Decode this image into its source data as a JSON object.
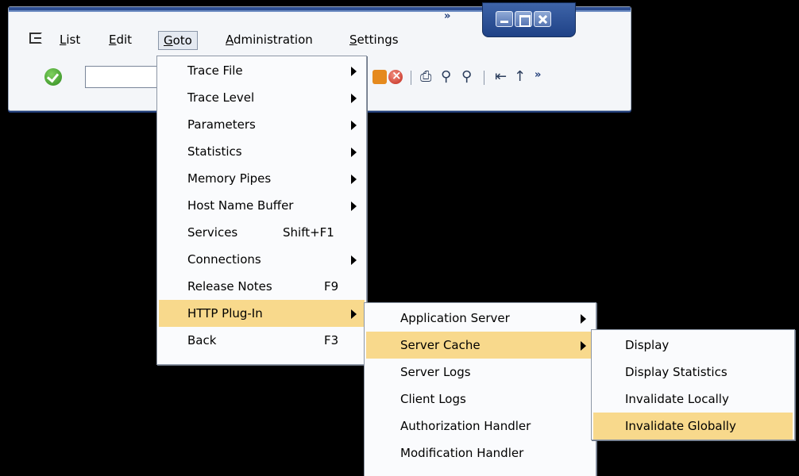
{
  "window": {
    "controls": {
      "more": "»",
      "minimize_icon": "minimize-icon",
      "maximize_icon": "maximize-icon",
      "close_icon": "close-icon"
    }
  },
  "menubar": {
    "items": [
      "List",
      "Edit",
      "Goto",
      "Administration",
      "Settings"
    ],
    "mnemonics": [
      "L",
      "E",
      "G",
      "A",
      "S"
    ]
  },
  "toolbar": {
    "command_field_value": "",
    "more": "»",
    "icons": [
      "enter-icon",
      "exit-icon",
      "cancel-icon",
      "print-icon",
      "find-icon",
      "find-next-icon",
      "first-page-icon",
      "previous-page-icon"
    ]
  },
  "goto_menu": {
    "items": [
      {
        "label": "Trace File",
        "submenu": true
      },
      {
        "label": "Trace Level",
        "submenu": true
      },
      {
        "label": "Parameters",
        "submenu": true
      },
      {
        "label": "Statistics",
        "submenu": true
      },
      {
        "label": "Memory Pipes",
        "submenu": true
      },
      {
        "label": "Host Name Buffer",
        "submenu": true
      },
      {
        "label": "Services",
        "shortcut": "Shift+F1"
      },
      {
        "label": "Connections",
        "submenu": true
      },
      {
        "label": "Release Notes",
        "shortcut": "F9"
      },
      {
        "label": "HTTP Plug-In",
        "submenu": true,
        "highlighted": true
      },
      {
        "label": "Back",
        "shortcut": "F3"
      }
    ]
  },
  "http_plugin_submenu": {
    "items": [
      {
        "label": "Application Server",
        "submenu": true
      },
      {
        "label": "Server Cache",
        "submenu": true,
        "highlighted": true
      },
      {
        "label": "Server Logs"
      },
      {
        "label": "Client Logs"
      },
      {
        "label": "Authorization Handler"
      },
      {
        "label": "Modification Handler"
      }
    ]
  },
  "server_cache_submenu": {
    "items": [
      {
        "label": "Display"
      },
      {
        "label": "Display Statistics"
      },
      {
        "label": "Invalidate Locally"
      },
      {
        "label": "Invalidate Globally",
        "highlighted": true
      }
    ]
  },
  "colors": {
    "highlight": "#f8d98c",
    "window_frame": "#2d4e92",
    "background": "#000000"
  }
}
